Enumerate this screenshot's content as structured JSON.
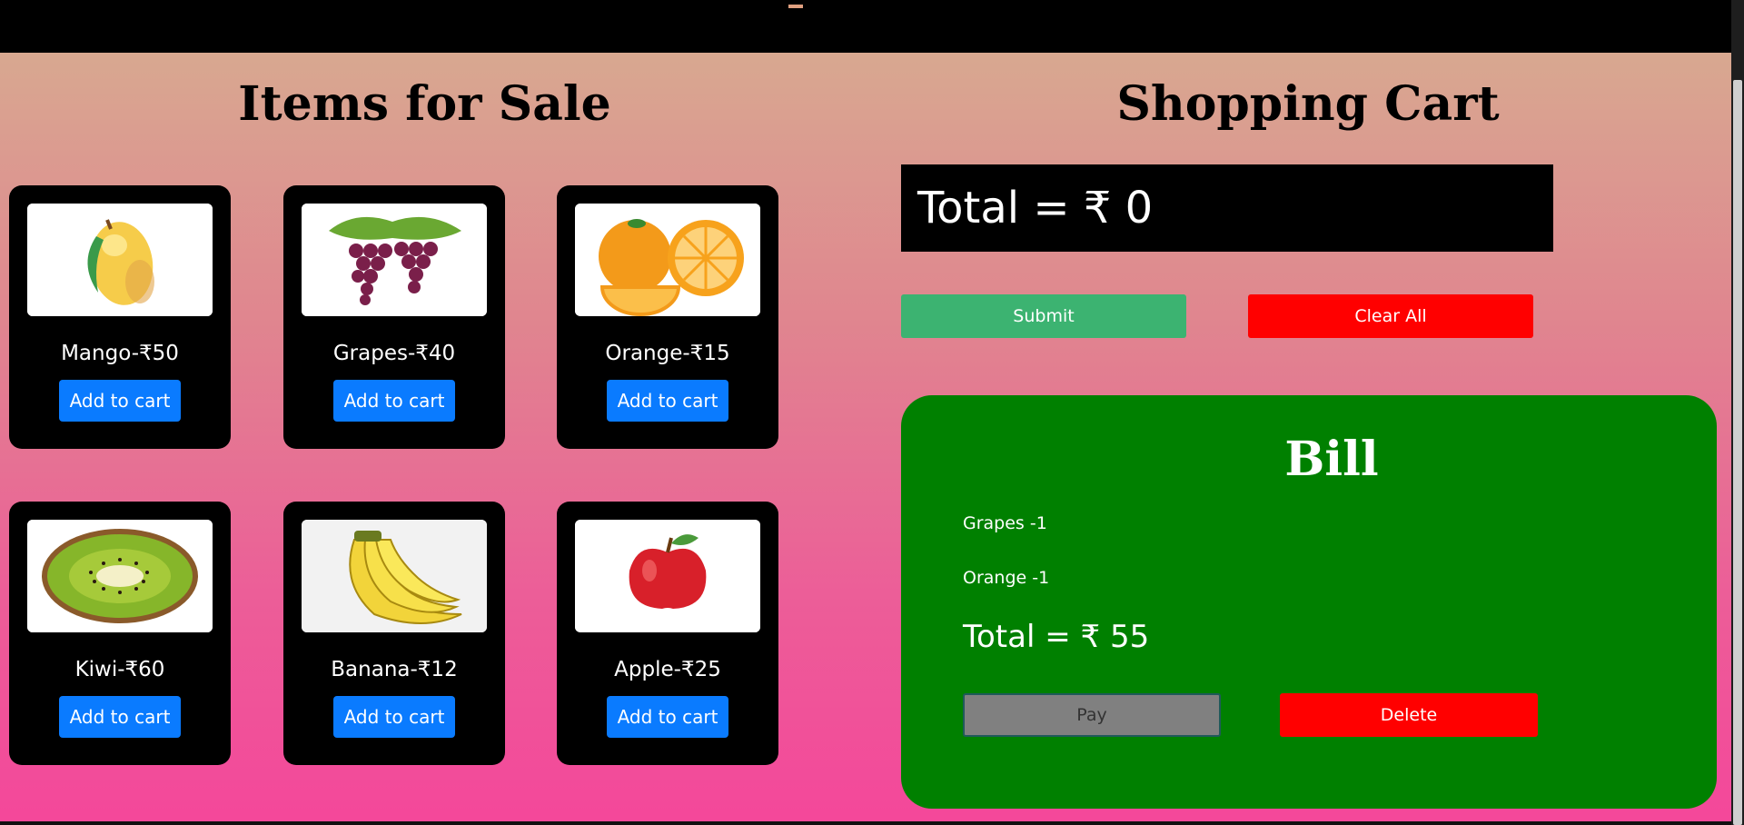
{
  "items_section": {
    "title": "Items for Sale",
    "add_label": "Add to cart",
    "products": [
      {
        "label": "Mango-₹50",
        "icon": "mango-icon"
      },
      {
        "label": "Grapes-₹40",
        "icon": "grapes-icon"
      },
      {
        "label": "Orange-₹15",
        "icon": "orange-icon"
      },
      {
        "label": "Kiwi-₹60",
        "icon": "kiwi-icon"
      },
      {
        "label": "Banana-₹12",
        "icon": "banana-icon"
      },
      {
        "label": "Apple-₹25",
        "icon": "apple-icon"
      }
    ]
  },
  "cart": {
    "title": "Shopping Cart",
    "total_text": "Total = ₹ 0",
    "submit_label": "Submit",
    "clear_label": "Clear All"
  },
  "bill": {
    "title": "Bill",
    "items": [
      "Grapes -1",
      "Orange -1"
    ],
    "total_text": "Total = ₹ 55",
    "pay_label": "Pay",
    "delete_label": "Delete"
  },
  "colors": {
    "add_button": "#0a7bff",
    "submit_button": "#3cb371",
    "clear_button": "#ff0000",
    "bill_background": "#008000",
    "pay_button": "#808080",
    "delete_button": "#ff0000"
  }
}
